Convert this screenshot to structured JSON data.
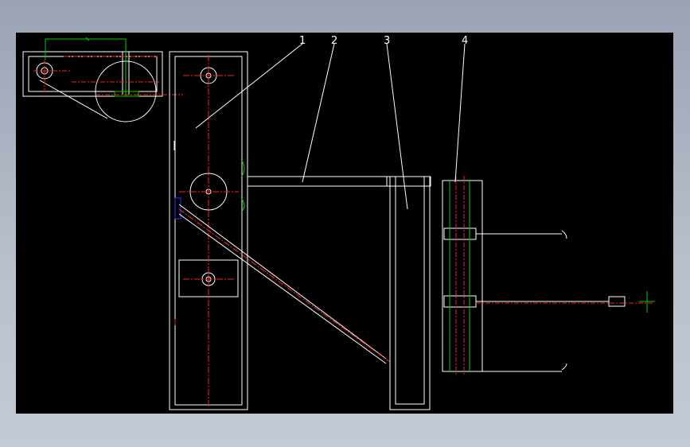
{
  "drawing": {
    "part_labels": [
      "1",
      "2",
      "3",
      "4"
    ],
    "colors": {
      "background": "#000000",
      "outline": "#ffffff",
      "centerline": "#ff2020",
      "dimension": "#00d000",
      "hidden": "#3030ff",
      "frame": "#9aa3b4"
    }
  }
}
